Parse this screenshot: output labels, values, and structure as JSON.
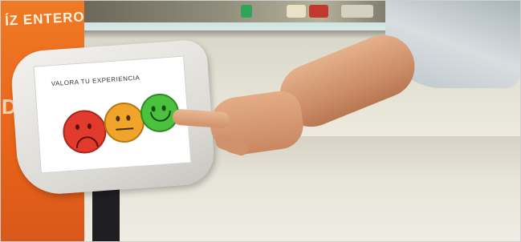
{
  "photo": {
    "banner_text": "ÍZ ENTERO",
    "banner_side_text": "DE C",
    "kiosk": {
      "screen_title": "VALORA TU EXPERIENCIA",
      "faces": [
        {
          "mood": "sad",
          "color": "#e23b2e"
        },
        {
          "mood": "neutral",
          "color": "#f0a52a"
        },
        {
          "mood": "happy",
          "color": "#4cc13d"
        }
      ]
    }
  }
}
